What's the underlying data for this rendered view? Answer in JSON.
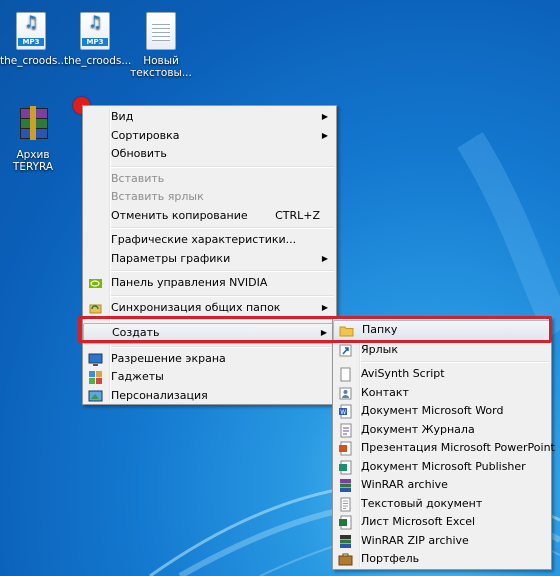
{
  "desktop": {
    "icons": [
      {
        "label": "the_croods...",
        "type": "mp3",
        "badge": "MP3"
      },
      {
        "label": "the_croods...",
        "type": "mp3",
        "badge": "MP3"
      },
      {
        "label": "Новый текстовы...",
        "type": "txt"
      },
      {
        "label": "Архив TERYRA",
        "type": "rar"
      }
    ]
  },
  "context_menu": {
    "items": [
      {
        "label": "Вид",
        "submenu": true
      },
      {
        "label": "Сортировка",
        "submenu": true
      },
      {
        "label": "Обновить"
      },
      {
        "label": "Вставить",
        "disabled": true
      },
      {
        "label": "Вставить ярлык",
        "disabled": true
      },
      {
        "label": "Отменить копирование",
        "shortcut": "CTRL+Z"
      },
      {
        "label": "Графические характеристики..."
      },
      {
        "label": "Параметры графики",
        "submenu": true
      },
      {
        "label": "Панель управления NVIDIA",
        "icon": "nvidia-icon"
      },
      {
        "label": "Синхронизация общих папок",
        "submenu": true,
        "icon": "sync-folders-icon"
      },
      {
        "label": "Создать",
        "submenu": true,
        "highlighted": true
      },
      {
        "label": "Разрешение экрана",
        "icon": "screen-resolution-icon"
      },
      {
        "label": "Гаджеты",
        "icon": "gadgets-icon"
      },
      {
        "label": "Персонализация",
        "icon": "personalization-icon"
      }
    ]
  },
  "create_submenu": {
    "items": [
      {
        "label": "Папку",
        "icon": "folder-icon",
        "highlighted": true
      },
      {
        "label": "Ярлык",
        "icon": "shortcut-icon"
      },
      {
        "label": "AviSynth Script",
        "icon": "document-icon"
      },
      {
        "label": "Контакт",
        "icon": "contact-icon"
      },
      {
        "label": "Документ Microsoft Word",
        "icon": "word-icon"
      },
      {
        "label": "Документ Журнала",
        "icon": "journal-icon"
      },
      {
        "label": "Презентация Microsoft PowerPoint",
        "icon": "powerpoint-icon"
      },
      {
        "label": "Документ Microsoft Publisher",
        "icon": "publisher-icon"
      },
      {
        "label": "WinRAR archive",
        "icon": "winrar-icon"
      },
      {
        "label": "Текстовый документ",
        "icon": "text-document-icon"
      },
      {
        "label": "Лист Microsoft Excel",
        "icon": "excel-icon"
      },
      {
        "label": "WinRAR ZIP archive",
        "icon": "winrar-zip-icon"
      },
      {
        "label": "Портфель",
        "icon": "briefcase-icon"
      }
    ]
  },
  "colors": {
    "highlight_frame": "#d71f2a",
    "desktop_blue": "#1479d0",
    "annotation_dot": "#e21b1b"
  }
}
